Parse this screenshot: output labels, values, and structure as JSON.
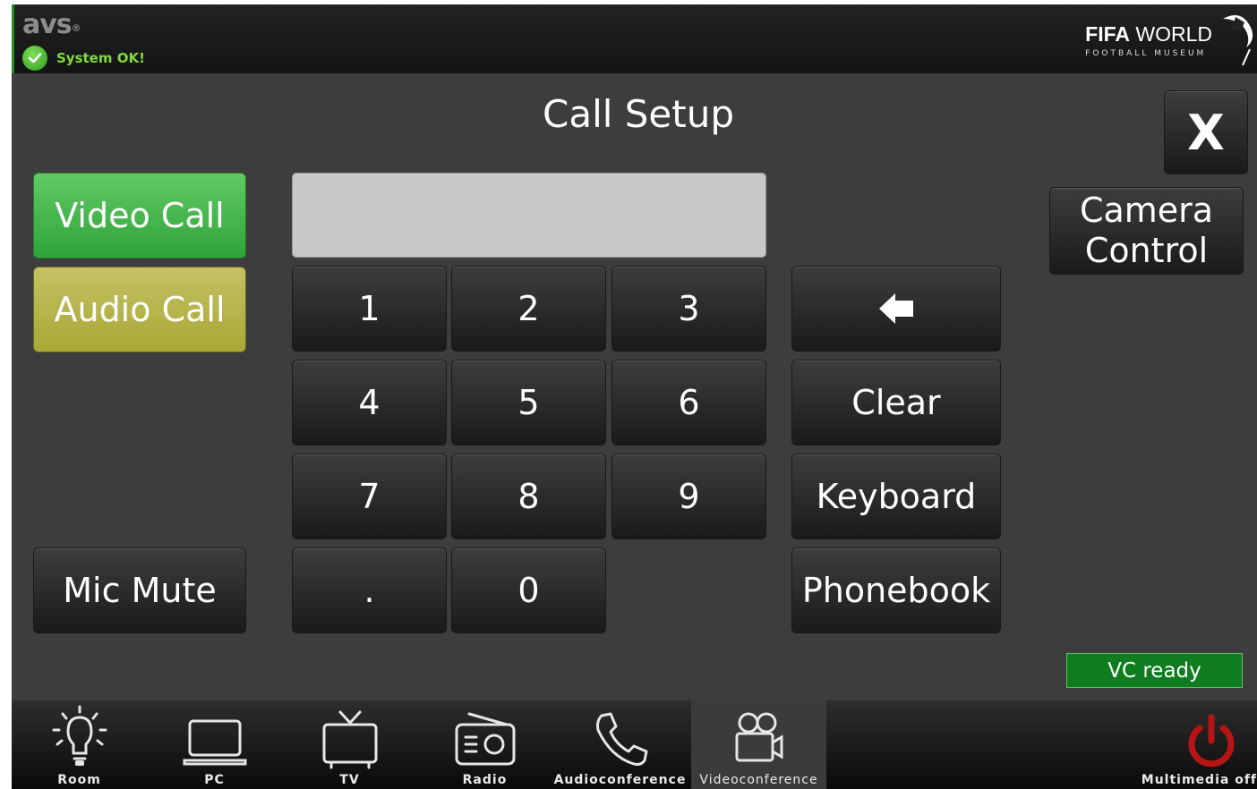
{
  "header": {
    "logo": "avs",
    "status": "System OK!",
    "brand_bold": "FIFA",
    "brand_rest": " WORLD",
    "brand_sub": "FOOTBALL MUSEUM"
  },
  "title": "Call Setup",
  "close_label": "X",
  "camera_control": [
    "Camera",
    "Control"
  ],
  "left_buttons": {
    "video_call": "Video Call",
    "audio_call": "Audio Call",
    "mic_mute": "Mic Mute"
  },
  "dial_input": {
    "value": ""
  },
  "keypad": [
    "1",
    "2",
    "3",
    "4",
    "5",
    "6",
    "7",
    "8",
    "9",
    ".",
    "0"
  ],
  "actions": {
    "clear": "Clear",
    "keyboard": "Keyboard",
    "phonebook": "Phonebook",
    "backspace_icon": "backspace-arrow-icon"
  },
  "status_badge": "VC ready",
  "colors": {
    "video_call": "#4cba4f",
    "audio_call": "#bcb94f",
    "vc_ready": "#0f7c1f",
    "status_ok": "#7fd93c",
    "power": "#b81414"
  },
  "nav": [
    {
      "label": "Room",
      "icon": "lightbulb-icon"
    },
    {
      "label": "PC",
      "icon": "laptop-icon"
    },
    {
      "label": "TV",
      "icon": "tv-icon"
    },
    {
      "label": "Radio",
      "icon": "radio-icon"
    },
    {
      "label": "Audioconference",
      "icon": "phone-icon"
    },
    {
      "label": "Videoconference",
      "icon": "video-camera-icon",
      "active": true
    },
    {
      "label": "Multimedia off",
      "icon": "power-icon"
    }
  ]
}
